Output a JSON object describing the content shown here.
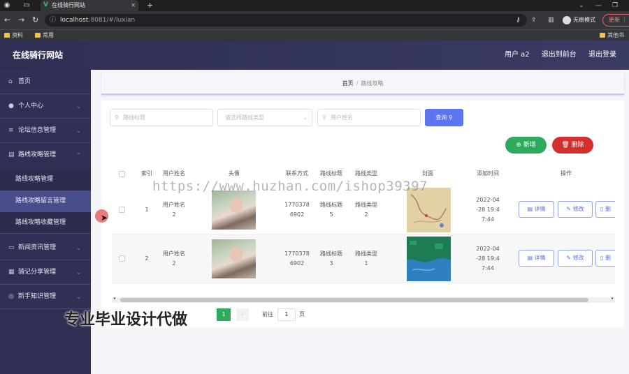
{
  "browser": {
    "tab_title": "在线骑行网站",
    "url_host": "localhost",
    "url_path": ":8081/#/luxian",
    "incognito_label": "无痕模式",
    "update_label": "更新",
    "bookmarks": [
      "资料",
      "常用"
    ],
    "bookmarks_right": "其他书签"
  },
  "header": {
    "brand": "在线骑行网站",
    "user": "用户 a2",
    "back_to_front": "退出到前台",
    "logout": "退出登录"
  },
  "sidebar": {
    "items": [
      {
        "label": "首页",
        "icon": "home-icon"
      },
      {
        "label": "个人中心",
        "icon": "user-icon"
      },
      {
        "label": "论坛信息管理",
        "icon": "list-icon"
      },
      {
        "label": "路线攻略管理",
        "icon": "doc-icon"
      }
    ],
    "subitems": [
      {
        "label": "路线攻略管理"
      },
      {
        "label": "路线攻略留言管理"
      },
      {
        "label": "路线攻略收藏管理"
      }
    ],
    "items_after": [
      {
        "label": "新闻资讯管理",
        "icon": "news-icon"
      },
      {
        "label": "骑记分享管理",
        "icon": "grid-icon"
      },
      {
        "label": "新手知识管理",
        "icon": "compass-icon"
      }
    ]
  },
  "breadcrumb": {
    "home": "首页",
    "separator": "/",
    "current": "路线攻略"
  },
  "filters": {
    "title_placeholder": "路线标题",
    "type_placeholder": "请选择路线类型",
    "user_placeholder": "用户姓名",
    "query_label": "查询"
  },
  "actions": {
    "add_label": "新增",
    "delete_label": "删除"
  },
  "table": {
    "columns": [
      "索引",
      "用户姓名",
      "头像",
      "联系方式",
      "路线标题",
      "路线类型",
      "封面",
      "添加时间",
      "操作"
    ],
    "rows": [
      {
        "index": "1",
        "user_1": "用户姓名",
        "user_2": "2",
        "phone_1": "1770378",
        "phone_2": "6902",
        "title_1": "路线标题",
        "title_2": "5",
        "type_1": "路线类型",
        "type_2": "2",
        "time_1": "2022-04",
        "time_2": "-28 19:4",
        "time_3": "7:44"
      },
      {
        "index": "2",
        "user_1": "用户姓名",
        "user_2": "2",
        "phone_1": "1770378",
        "phone_2": "6902",
        "title_1": "路线标题",
        "title_2": "3",
        "type_1": "路线类型",
        "type_2": "1",
        "time_1": "2022-04",
        "time_2": "-28 19:4",
        "time_3": "7:44"
      }
    ],
    "ops": {
      "detail": "详情",
      "edit": "修改",
      "delete": "删"
    }
  },
  "pagination": {
    "current": "1",
    "goto_label": "前往",
    "goto_value": "1",
    "unit": "页"
  },
  "overlays": {
    "watermark": "https://www.huzhan.com/ishop39397",
    "promo": "专业毕业设计代做"
  },
  "colors": {
    "sidebar": "#2f3054",
    "primary": "#5b74f0",
    "success": "#2daa5d",
    "danger": "#d42f2f"
  }
}
